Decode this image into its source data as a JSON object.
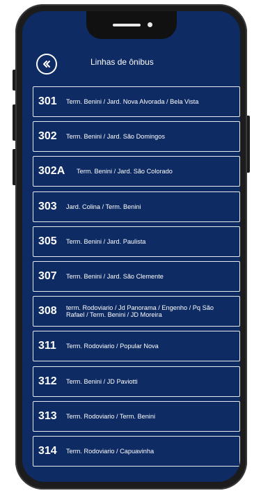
{
  "header": {
    "title": "Linhas de ônibus"
  },
  "routes": [
    {
      "number": "301",
      "description": "Term. Benini / Jard. Nova Alvorada / Bela Vista"
    },
    {
      "number": "302",
      "description": "Term. Benini / Jard. São Domingos"
    },
    {
      "number": "302A",
      "description": "Term. Benini / Jard. São Colorado"
    },
    {
      "number": "303",
      "description": "Jard. Colina / Term. Benini"
    },
    {
      "number": "305",
      "description": "Term. Benini / Jard. Paulista"
    },
    {
      "number": "307",
      "description": "Term. Benini / Jard. São Clemente"
    },
    {
      "number": "308",
      "description": "term. Rodoviario / Jd Panorama / Engenho / Pq São Rafael / Term. Benini / JD Moreira"
    },
    {
      "number": "311",
      "description": "Term. Rodoviario / Popular Nova"
    },
    {
      "number": "312",
      "description": "Term. Benini / JD Paviotti"
    },
    {
      "number": "313",
      "description": "Term. Rodoviario / Term. Benini"
    },
    {
      "number": "314",
      "description": "Term. Rodoviario / Capuavinha"
    }
  ],
  "colors": {
    "background": "#0e2b63",
    "text": "#ffffff",
    "border": "#e6e9f0"
  },
  "icons": {
    "back": "double-chevron-left-icon"
  }
}
